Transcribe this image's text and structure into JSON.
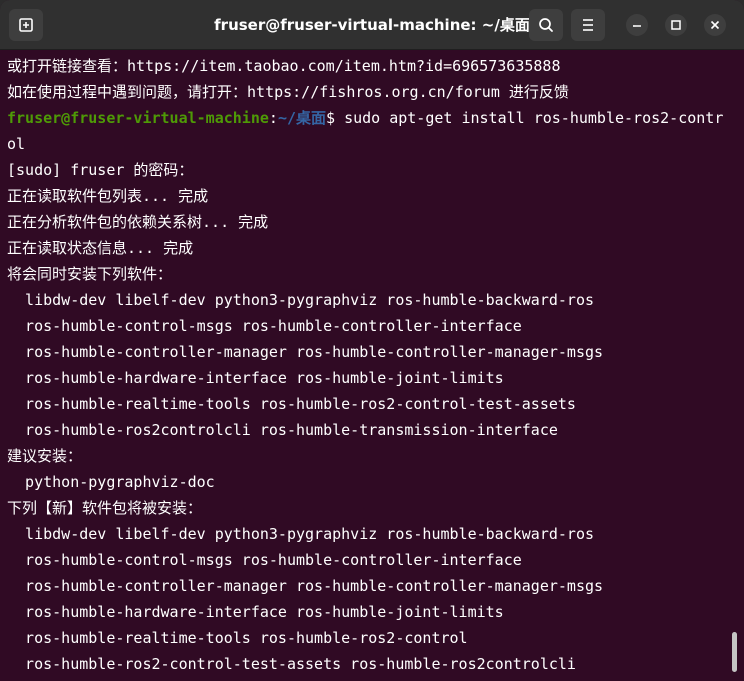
{
  "window": {
    "title": "fruser@fruser-virtual-machine: ~/桌面",
    "accent_bg": "#300a24",
    "icons": {
      "new_tab": "new-tab-icon",
      "search": "search-icon",
      "menu": "hamburger-menu-icon",
      "minimize": "minimize-icon",
      "maximize": "maximize-icon",
      "close": "close-icon"
    }
  },
  "terminal": {
    "prompt_colors": {
      "user": "#4e9a06",
      "path": "#3465a4"
    },
    "lines": [
      {
        "type": "text",
        "text": "或打开链接查看：https://item.taobao.com/item.htm?id=696573635888"
      },
      {
        "type": "text",
        "text": "如在使用过程中遇到问题，请打开：https://fishros.org.cn/forum 进行反馈"
      },
      {
        "type": "prompt",
        "user": "fruser@fruser-virtual-machine",
        "sep": ":",
        "path": "~/桌面",
        "symbol": "$ ",
        "command": "sudo apt-get install ros-humble-ros2-contr"
      },
      {
        "type": "text",
        "text": "ol"
      },
      {
        "type": "text",
        "text": "[sudo] fruser 的密码："
      },
      {
        "type": "text",
        "text": "正在读取软件包列表... 完成"
      },
      {
        "type": "text",
        "text": "正在分析软件包的依赖关系树... 完成"
      },
      {
        "type": "text",
        "text": "正在读取状态信息... 完成"
      },
      {
        "type": "text",
        "text": "将会同时安装下列软件："
      },
      {
        "type": "text",
        "text": "  libdw-dev libelf-dev python3-pygraphviz ros-humble-backward-ros"
      },
      {
        "type": "text",
        "text": "  ros-humble-control-msgs ros-humble-controller-interface"
      },
      {
        "type": "text",
        "text": "  ros-humble-controller-manager ros-humble-controller-manager-msgs"
      },
      {
        "type": "text",
        "text": "  ros-humble-hardware-interface ros-humble-joint-limits"
      },
      {
        "type": "text",
        "text": "  ros-humble-realtime-tools ros-humble-ros2-control-test-assets"
      },
      {
        "type": "text",
        "text": "  ros-humble-ros2controlcli ros-humble-transmission-interface"
      },
      {
        "type": "text",
        "text": "建议安装："
      },
      {
        "type": "text",
        "text": "  python-pygraphviz-doc"
      },
      {
        "type": "text",
        "text": "下列【新】软件包将被安装："
      },
      {
        "type": "text",
        "text": "  libdw-dev libelf-dev python3-pygraphviz ros-humble-backward-ros"
      },
      {
        "type": "text",
        "text": "  ros-humble-control-msgs ros-humble-controller-interface"
      },
      {
        "type": "text",
        "text": "  ros-humble-controller-manager ros-humble-controller-manager-msgs"
      },
      {
        "type": "text",
        "text": "  ros-humble-hardware-interface ros-humble-joint-limits"
      },
      {
        "type": "text",
        "text": "  ros-humble-realtime-tools ros-humble-ros2-control"
      },
      {
        "type": "text",
        "text": "  ros-humble-ros2-control-test-assets ros-humble-ros2controlcli"
      }
    ]
  }
}
